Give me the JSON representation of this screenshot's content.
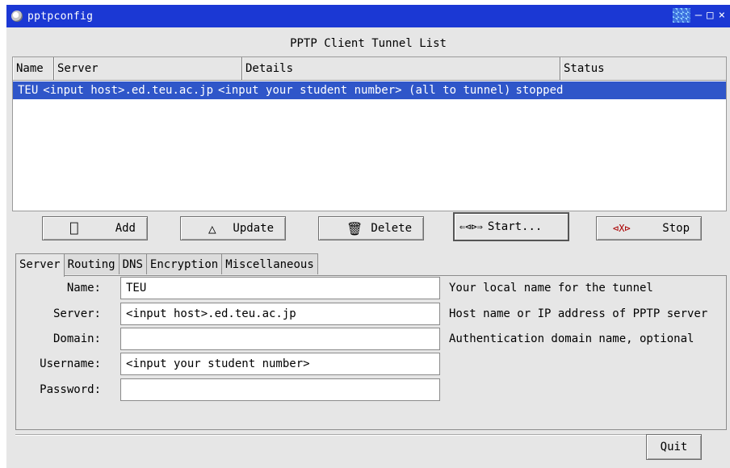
{
  "window": {
    "title": "pptpconfig",
    "controls": [
      "–",
      "□",
      "×"
    ]
  },
  "tunnel_list": {
    "title": "PPTP Client Tunnel List",
    "columns": [
      "Name",
      "Server",
      "Details",
      "Status"
    ],
    "rows": [
      {
        "name": "TEU",
        "server": "<input host>.ed.teu.ac.jp",
        "details": "<input your student number> (all to tunnel)",
        "status": "stopped"
      }
    ]
  },
  "buttons": {
    "add": {
      "label": "Add",
      "icon": "new-doc-icon",
      "glyph": "⎕"
    },
    "update": {
      "label": "Update",
      "icon": "triangle-icon",
      "glyph": "△"
    },
    "delete": {
      "label": "Delete",
      "icon": "trash-icon",
      "glyph": "🗑"
    },
    "start": {
      "label": "Start...",
      "icon": "connect-plug-icon",
      "glyph": "⇐⊲⊳⇒"
    },
    "stop": {
      "label": "Stop",
      "icon": "disconnect-plug-icon",
      "glyph": "⊲X⊳"
    },
    "quit": {
      "label": "Quit"
    }
  },
  "tabs": [
    "Server",
    "Routing",
    "DNS",
    "Encryption",
    "Miscellaneous"
  ],
  "active_tab": "Server",
  "form": {
    "name": {
      "label": "Name:",
      "value": "TEU",
      "help": "Your local name for the tunnel"
    },
    "server": {
      "label": "Server:",
      "value": "<input host>.ed.teu.ac.jp",
      "help": "Host name or IP address of PPTP server"
    },
    "domain": {
      "label": "Domain:",
      "value": "",
      "help": "Authentication domain name, optional"
    },
    "username": {
      "label": "Username:",
      "value": "<input your student number>",
      "help": ""
    },
    "password": {
      "label": "Password:",
      "value": "",
      "help": ""
    }
  },
  "colors": {
    "titlebar": "#1b38d4",
    "selection": "#2f56c9",
    "background": "#e6e6e6"
  }
}
